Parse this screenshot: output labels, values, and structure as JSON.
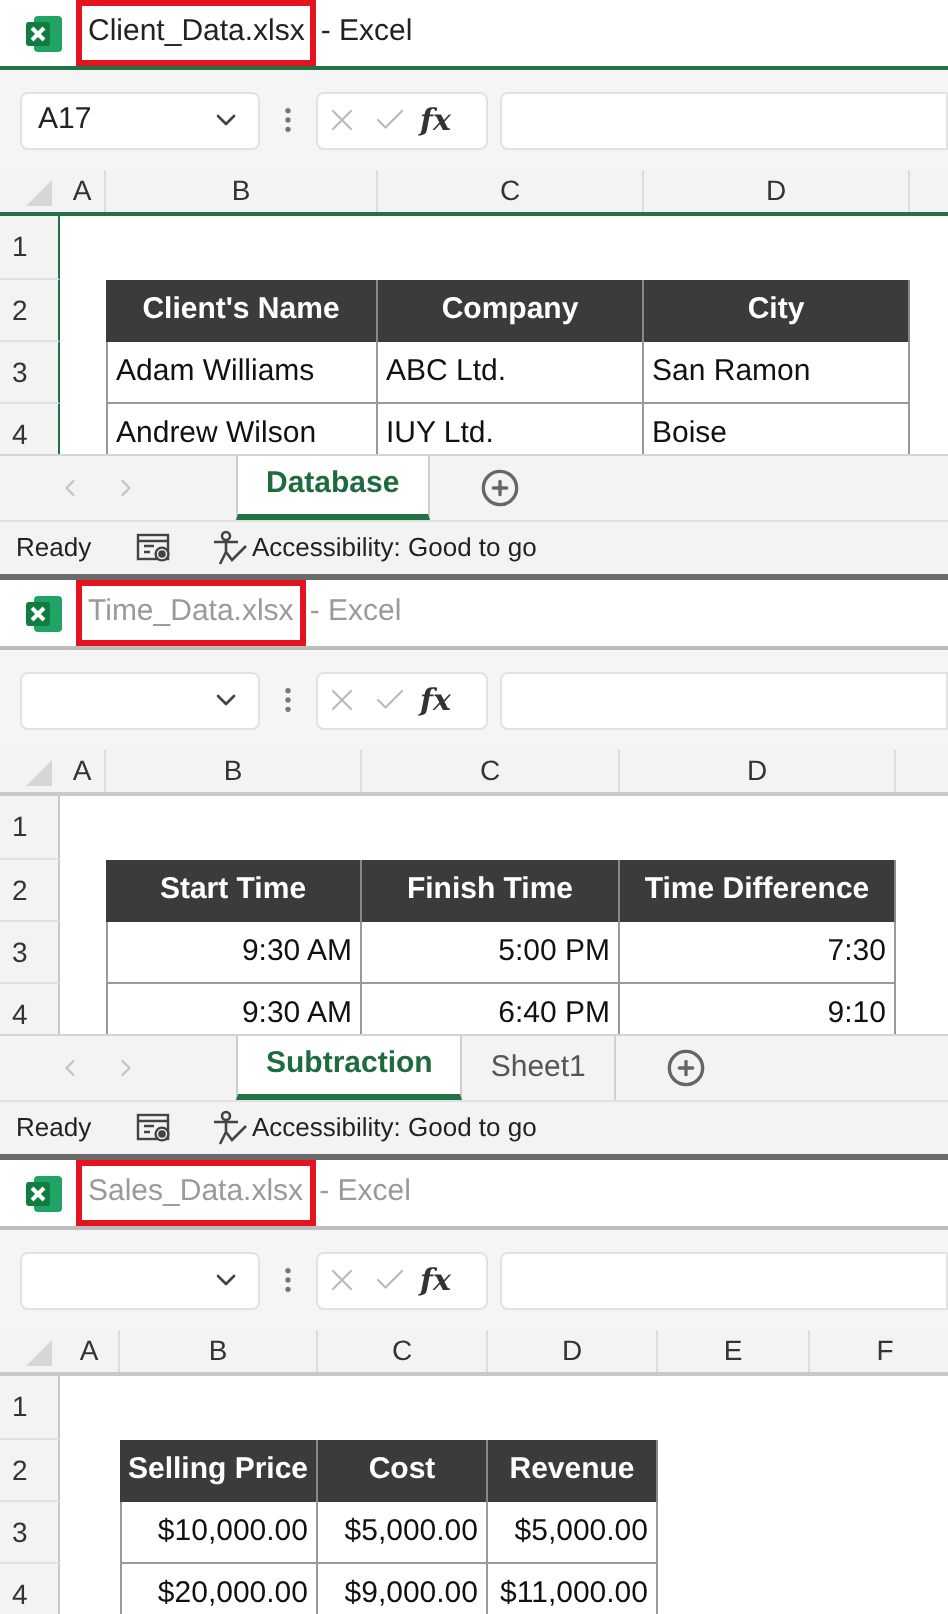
{
  "windows": [
    {
      "title": {
        "filename": "Client_Data.xlsx",
        "app": "- Excel",
        "active": true,
        "highlighted": true
      },
      "name_box": "A17",
      "function_label": "fx",
      "columns": [
        "A",
        "B",
        "C",
        "D"
      ],
      "row_numbers": [
        "1",
        "2",
        "3",
        "4"
      ],
      "table": {
        "kind": "text",
        "headers": [
          "Client's Name",
          "Company",
          "City"
        ],
        "rows": [
          [
            "Adam Williams",
            "ABC Ltd.",
            "San Ramon"
          ],
          [
            "Andrew Wilson",
            "IUY Ltd.",
            "Boise"
          ]
        ]
      },
      "sheet_tabs": [
        {
          "label": "Database",
          "selected": true
        }
      ],
      "status_bar": {
        "mode": "Ready",
        "accessibility": "Accessibility: Good to go"
      }
    },
    {
      "title": {
        "filename": "Time_Data.xlsx",
        "app": "- Excel",
        "active": false,
        "highlighted": true
      },
      "function_label": "fx",
      "columns": [
        "A",
        "B",
        "C",
        "D"
      ],
      "row_numbers": [
        "1",
        "2",
        "3",
        "4"
      ],
      "table": {
        "kind": "number",
        "headers": [
          "Start Time",
          "Finish Time",
          "Time Difference"
        ],
        "rows": [
          [
            "9:30 AM",
            "5:00 PM",
            "7:30"
          ],
          [
            "9:30 AM",
            "6:40 PM",
            "9:10"
          ]
        ]
      },
      "sheet_tabs": [
        {
          "label": "Subtraction",
          "selected": true
        },
        {
          "label": "Sheet1",
          "selected": false
        }
      ],
      "status_bar": {
        "mode": "Ready",
        "accessibility": "Accessibility: Good to go"
      }
    },
    {
      "title": {
        "filename": "Sales_Data.xlsx",
        "app": "- Excel",
        "active": false,
        "highlighted": true
      },
      "function_label": "fx",
      "columns": [
        "A",
        "B",
        "C",
        "D",
        "E",
        "F"
      ],
      "row_numbers": [
        "1",
        "2",
        "3",
        "4"
      ],
      "table": {
        "kind": "number",
        "headers": [
          "Selling Price",
          "Cost",
          "Revenue"
        ],
        "rows": [
          [
            "$10,000.00",
            "$5,000.00",
            "$5,000.00"
          ],
          [
            "$20,000.00",
            "$9,000.00",
            "$11,000.00"
          ]
        ]
      }
    }
  ]
}
